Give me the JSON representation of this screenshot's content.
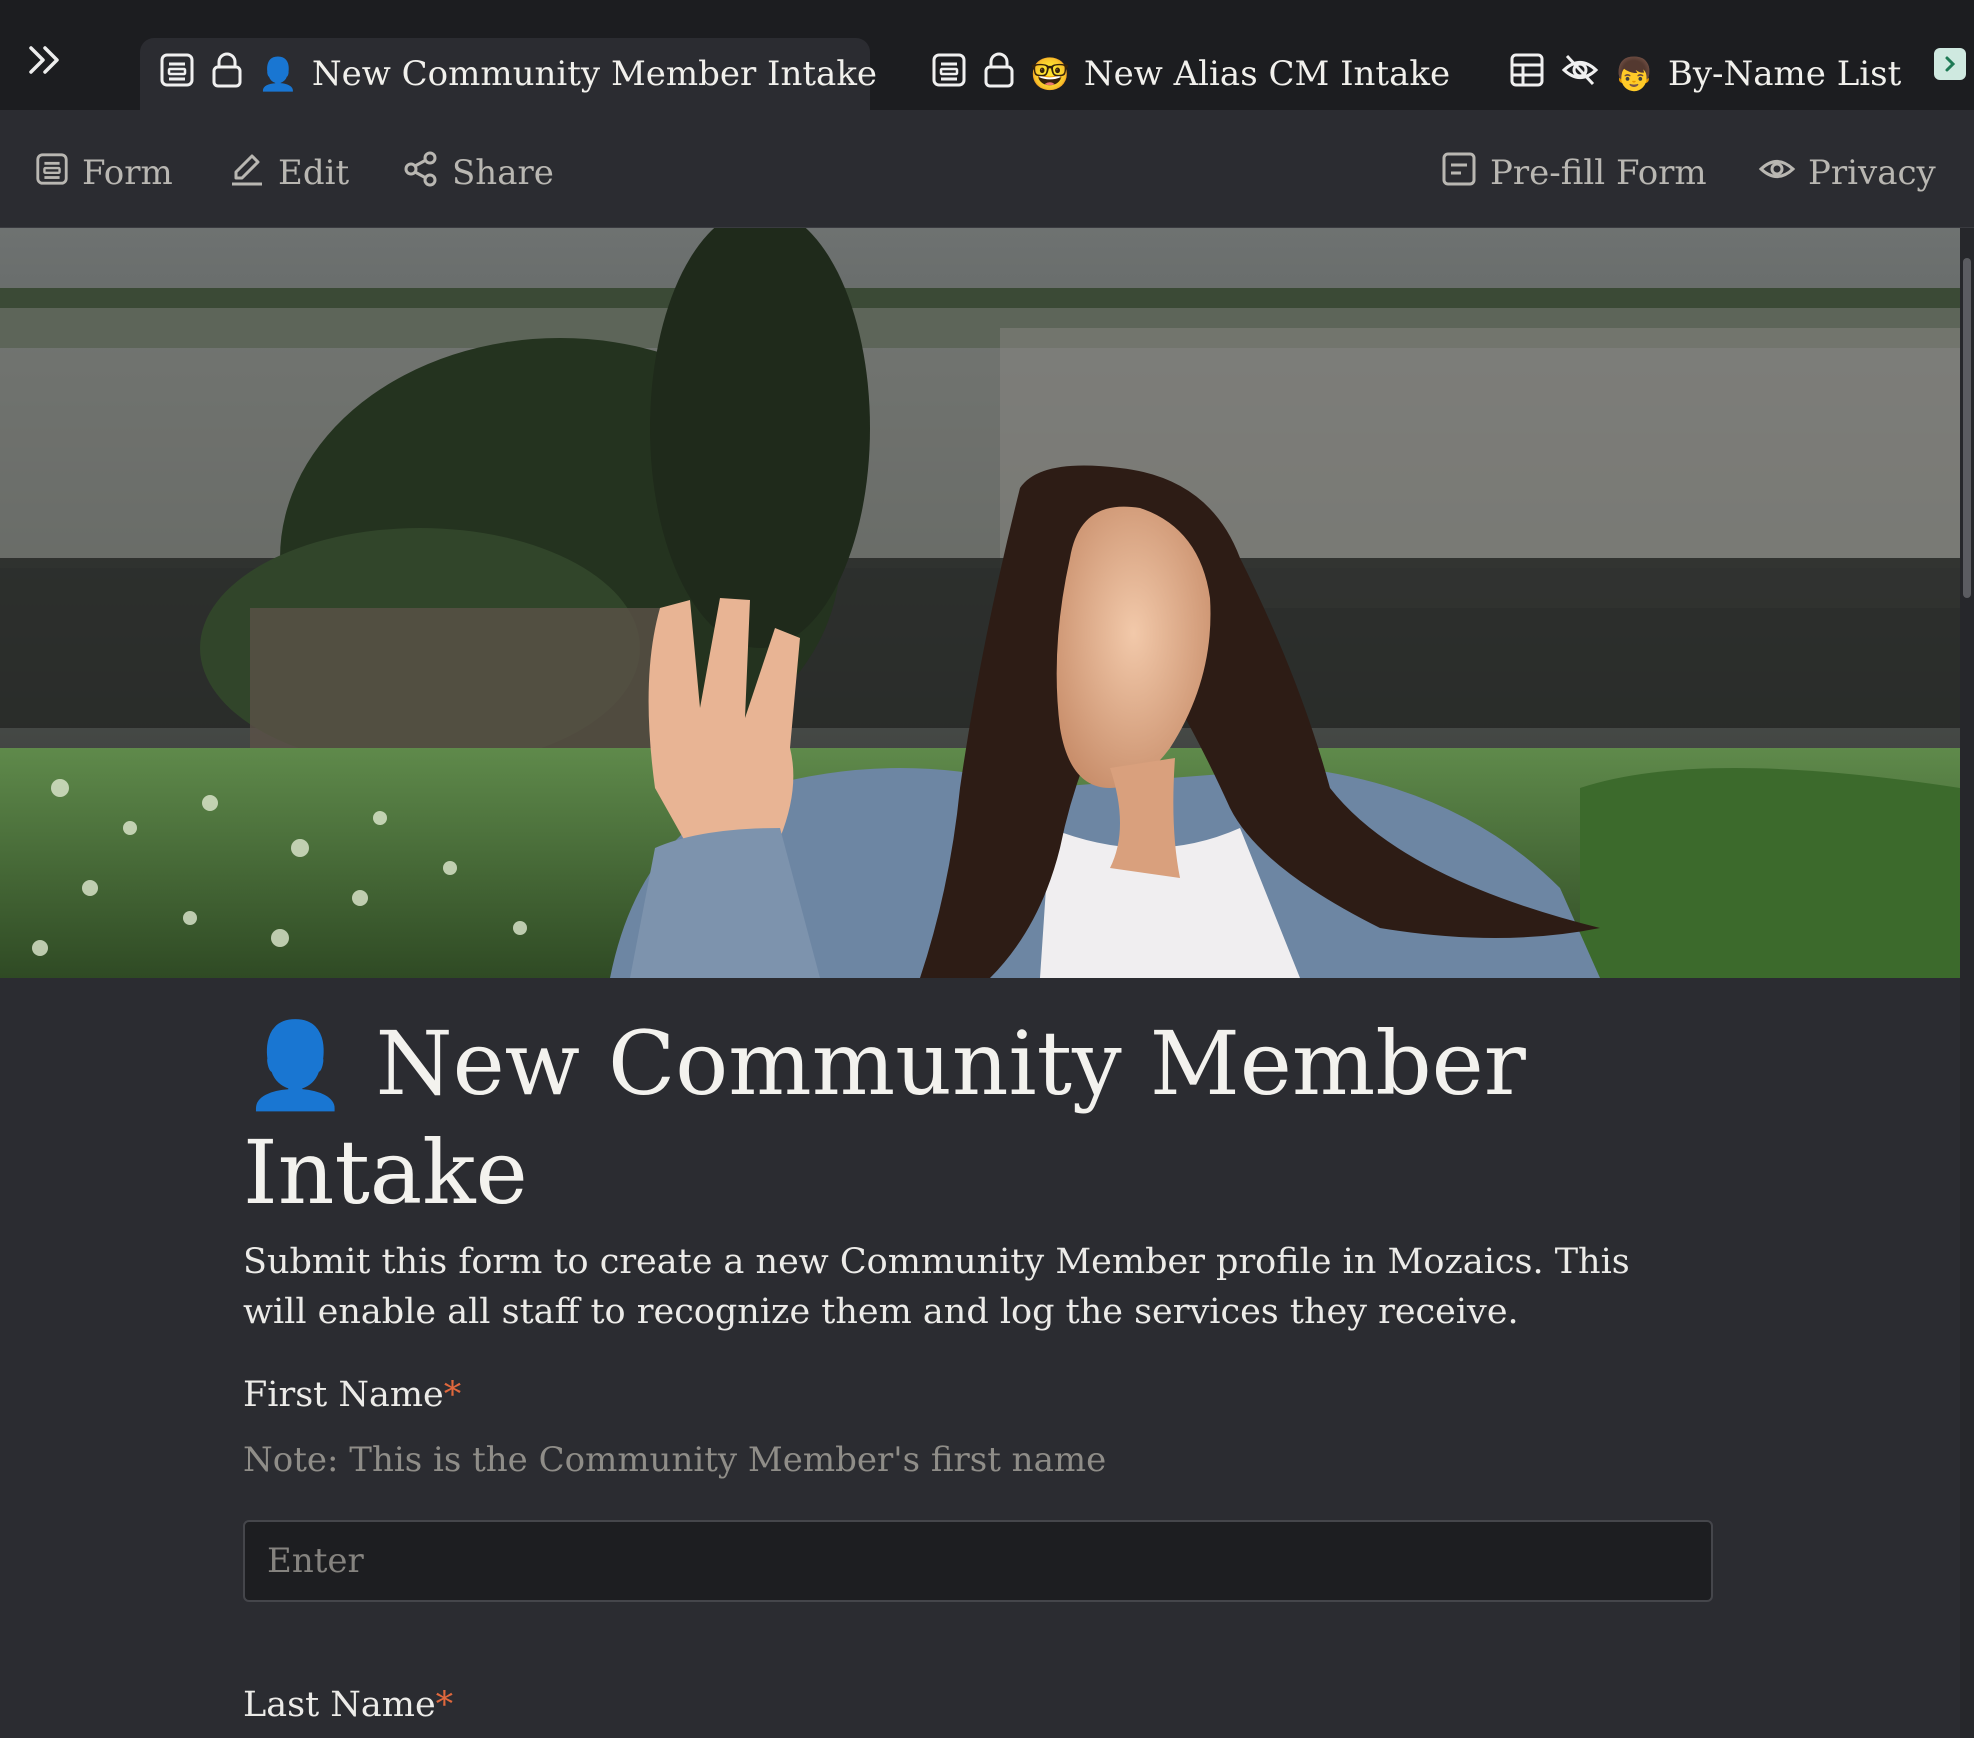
{
  "tabs": [
    {
      "label": "New Community Member Intake",
      "emoji": "👤",
      "active": true
    },
    {
      "label": "New Alias CM Intake",
      "emoji": "🤓",
      "active": false
    },
    {
      "label": "By-Name List",
      "emoji": "👦",
      "active": false
    }
  ],
  "toolbar": {
    "form": "Form",
    "edit": "Edit",
    "share": "Share",
    "prefill": "Pre-fill Form",
    "privacy": "Privacy"
  },
  "form": {
    "title_emoji": "👤",
    "title": "New Community Member Intake",
    "description": "Submit this form to create a new Community Member profile in Mozaics. This will enable all staff to recognize them and log the services they receive.",
    "fields": [
      {
        "label": "First Name",
        "required_mark": "*",
        "note": "Note: This is the Community Member's first name",
        "placeholder": "Enter",
        "value": ""
      },
      {
        "label": "Last Name",
        "required_mark": "*"
      }
    ]
  },
  "colors": {
    "background": "#2b2c31",
    "tabbar": "#1c1d20",
    "required": "#e0683d",
    "input_bg": "#1d1e21"
  }
}
